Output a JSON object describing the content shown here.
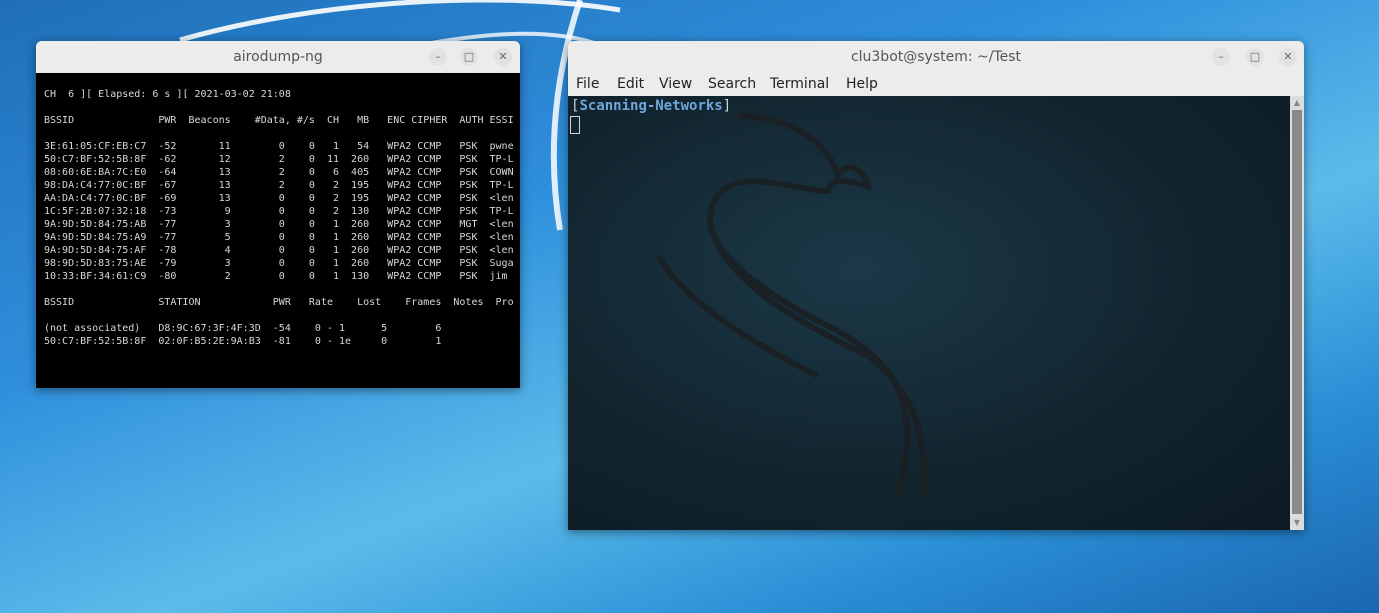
{
  "airodump": {
    "title": "airodump-ng",
    "lines": [
      "CH  6 ][ Elapsed: 6 s ][ 2021-03-02 21:08",
      "BSSID              PWR  Beacons    #Data, #/s  CH   MB   ENC CIPHER  AUTH ESSI",
      "3E:61:05:CF:EB:C7  -52       11        0    0   1   54   WPA2 CCMP   PSK  pwne",
      "50:C7:BF:52:5B:8F  -62       12        2    0  11  260   WPA2 CCMP   PSK  TP-L",
      "08:60:6E:BA:7C:E0  -64       13        2    0   6  405   WPA2 CCMP   PSK  COWN",
      "98:DA:C4:77:0C:BF  -67       13        2    0   2  195   WPA2 CCMP   PSK  TP-L",
      "AA:DA:C4:77:0C:BF  -69       13        0    0   2  195   WPA2 CCMP   PSK  <len",
      "1C:5F:2B:07:32:18  -73        9        0    0   2  130   WPA2 CCMP   PSK  TP-L",
      "9A:9D:5D:84:75:AB  -77        3        0    0   1  260   WPA2 CCMP   MGT  <len",
      "9A:9D:5D:84:75:A9  -77        5        0    0   1  260   WPA2 CCMP   PSK  <len",
      "9A:9D:5D:84:75:AF  -78        4        0    0   1  260   WPA2 CCMP   PSK  <len",
      "98:9D:5D:83:75:AE  -79        3        0    0   1  260   WPA2 CCMP   PSK  Suga",
      "10:33:BF:34:61:C9  -80        2        0    0   1  130   WPA2 CCMP   PSK  jim",
      "BSSID              STATION            PWR   Rate    Lost    Frames  Notes  Pro",
      "(not associated)   D8:9C:67:3F:4F:3D  -54    0 - 1      5        6",
      "50:C7:BF:52:5B:8F  02:0F:B5:2E:9A:B3  -81    0 - 1e     0        1"
    ]
  },
  "terminal": {
    "title": "clu3bot@system: ~/Test",
    "menu": [
      "File",
      "Edit",
      "View",
      "Search",
      "Terminal",
      "Help"
    ],
    "prompt_open": "[",
    "prompt_text": "Scanning-Networks",
    "prompt_close": "]"
  },
  "window_buttons": {
    "minimize": "–",
    "maximize": "□",
    "close": "✕"
  }
}
